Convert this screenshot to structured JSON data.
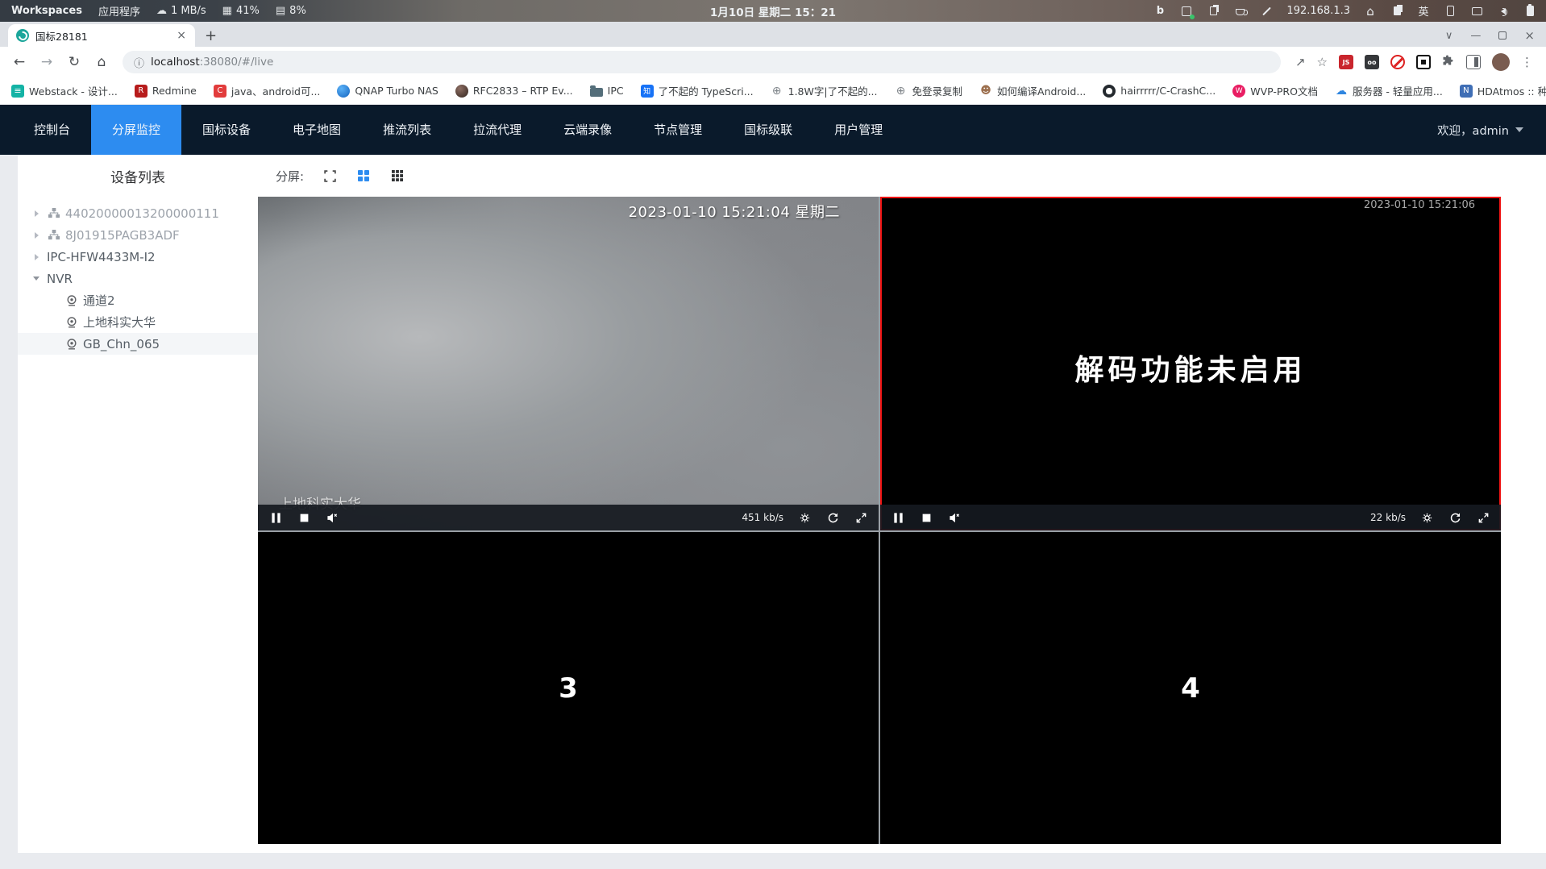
{
  "system_bar": {
    "workspaces": "Workspaces",
    "apps": "应用程序",
    "net_speed": "1 MB/s",
    "cpu": "41%",
    "mem": "8%",
    "clock": "1月10日 星期二 15：21",
    "tray": {
      "bing": "b",
      "ip": "192.168.1.3",
      "home": "⌂",
      "lang": "英"
    }
  },
  "browser": {
    "tab_title": "国标28181",
    "url_host": "localhost",
    "url_rest": ":38080/#/live",
    "bookmarks": [
      {
        "label": "Webstack - 设计...",
        "icon": "webstack",
        "glyph": "≡"
      },
      {
        "label": "Redmine",
        "icon": "redmine",
        "glyph": "R"
      },
      {
        "label": "java、android可...",
        "icon": "csdn",
        "glyph": "C"
      },
      {
        "label": "QNAP Turbo NAS",
        "icon": "qnap",
        "glyph": ""
      },
      {
        "label": "RFC2833 – RTP Ev...",
        "icon": "rfc",
        "glyph": ""
      },
      {
        "label": "IPC",
        "icon": "folder",
        "glyph": ""
      },
      {
        "label": "了不起的 TypeScri...",
        "icon": "zhihu",
        "glyph": "知"
      },
      {
        "label": "1.8W字|了不起的...",
        "icon": "globe",
        "glyph": "⊕"
      },
      {
        "label": "免登录复制",
        "icon": "globe",
        "glyph": "⊕"
      },
      {
        "label": "如何编译Android...",
        "icon": "person",
        "glyph": "☻"
      },
      {
        "label": "hairrrrr/C-CrashC...",
        "icon": "github",
        "glyph": ""
      },
      {
        "label": "WVP-PRO文档",
        "icon": "wvp",
        "glyph": "W"
      },
      {
        "label": "服务器 - 轻量应用...",
        "icon": "cloud",
        "glyph": "☁"
      },
      {
        "label": "HDAtmos :: 种子 *...",
        "icon": "hdatmos",
        "glyph": "N"
      }
    ],
    "bookmarks_overflow": "»",
    "ext_js": "JS"
  },
  "nav": {
    "items": [
      "控制台",
      "分屏监控",
      "国标设备",
      "电子地图",
      "推流列表",
      "拉流代理",
      "云端录像",
      "节点管理",
      "国标级联",
      "用户管理"
    ],
    "active_index": 1,
    "welcome": "欢迎，admin"
  },
  "sidebar": {
    "title": "设备列表",
    "tree": [
      {
        "label": "44020000013200000111",
        "type": "platform",
        "state": "collapsed",
        "online": false
      },
      {
        "label": "8J01915PAGB3ADF",
        "type": "platform",
        "state": "collapsed",
        "online": false
      },
      {
        "label": "IPC-HFW4433M-I2",
        "type": "device",
        "state": "collapsed",
        "online": true
      },
      {
        "label": "NVR",
        "type": "device",
        "state": "expanded",
        "online": true
      },
      {
        "label": "通道2",
        "type": "channel",
        "online": true
      },
      {
        "label": "上地科实大华",
        "type": "channel",
        "online": true
      },
      {
        "label": "GB_Chn_065",
        "type": "channel",
        "online": true,
        "selected": true
      }
    ]
  },
  "main": {
    "split_label": "分屏:",
    "players": {
      "p1": {
        "osd_time": "2023-01-10 15:21:04 星期二",
        "name": "上地科实大华",
        "bitrate": "451 kb/s"
      },
      "p2": {
        "osd_time": "2023-01-10 15:21:06",
        "message": "解码功能未启用",
        "bitrate": "22 kb/s"
      },
      "p3": {
        "number": "3"
      },
      "p4": {
        "number": "4"
      }
    }
  },
  "colors": {
    "accent": "#2d8cf0",
    "nav_bg": "#0a1a2b",
    "selected_border": "#f01414",
    "active_grid_icon": "#2d8cf0"
  }
}
